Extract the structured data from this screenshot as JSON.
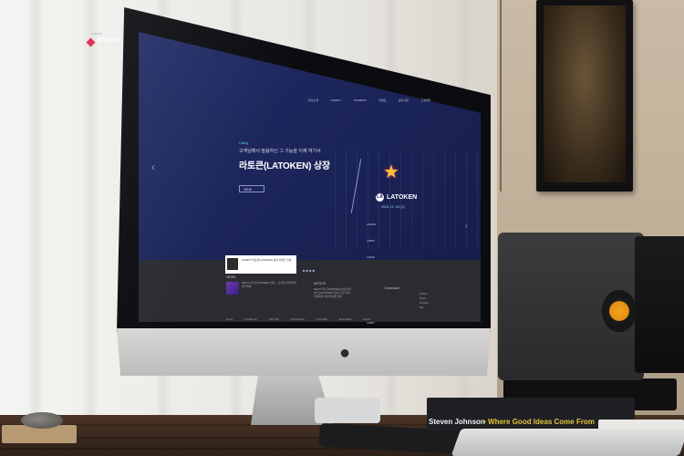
{
  "website": {
    "topbar_text": "SIGNUP",
    "logo_text": "STARXT",
    "nav": [
      "회사소개",
      "STARXT",
      "STARBOX",
      "이벤트",
      "공지사항",
      "고객센터"
    ],
    "hero": {
      "kicker": "Listing",
      "subtitle": "고객님께서 말씀하신 그 기능을 이제 여기서",
      "title": "라토큰(LATOKEN) 상장",
      "button_label": "VIEW",
      "partner_name": "LATOKEN",
      "partner_badge": "LA",
      "date": "2018. 12. 19 (수)",
      "pairs": [
        "LA/KRW",
        "LA/BTC",
        "LA/ETH",
        "LA/SRN",
        "LA/STARXT",
        "LA/PIX",
        "LA/BKT",
        "LA/XRP"
      ]
    },
    "popup_text": "STARXT 라토큰(LATOKEN) 상장 이벤트 안내",
    "news": {
      "label": "NEWS",
      "text": "StarXT '라토큰(LATOKEN)' 상장 — 글로벌 거래소와의 협력 확대"
    },
    "notice": {
      "label": "NOTICE",
      "items": [
        "StarXT 라토큰(LATOKEN) 상장 안내",
        "라토큰(LATOKEN) 입출금 오픈 안내",
        "가상화폐 거래 유의사항 안내"
      ]
    },
    "download": {
      "label": "Download",
      "items": [
        "Android",
        "iPhone",
        "Windows",
        "Mac"
      ]
    },
    "social": [
      "BLOG",
      "FACEBOOK",
      "TWITTER",
      "INSTAGRAM",
      "YOUTUBE",
      "TELEGRAM",
      "KAKAO"
    ]
  },
  "book": {
    "author": "Steven Johnson",
    "title": "Where Good Ideas Come From"
  },
  "colors": {
    "screen_bg": "#1a2456",
    "accent_teal": "#5ad2c8",
    "speaker_cone": "#f2a21c",
    "book_title": "#e8c43a"
  }
}
